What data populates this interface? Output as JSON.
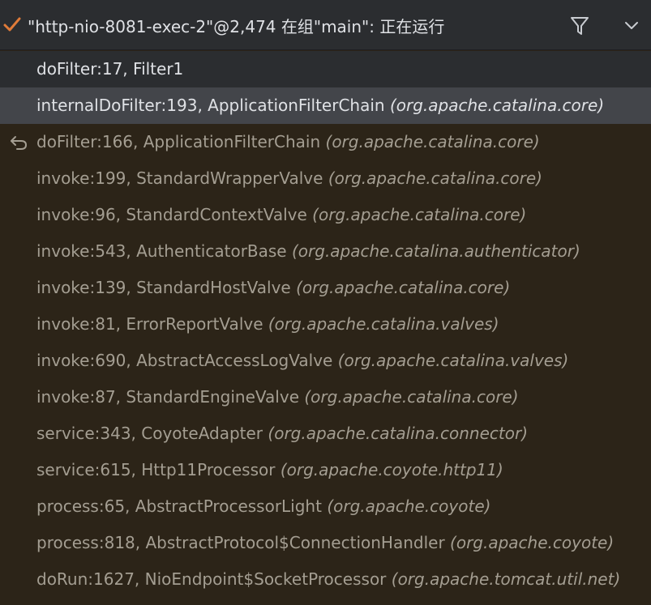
{
  "header": {
    "thread_title": "\"http-nio-8081-exec-2\"@2,474 在组\"main\": 正在运行",
    "status_icon": "check-icon",
    "status_color": "#e07b39",
    "filter_icon": "filter-icon",
    "expand_icon": "chevron-down-icon"
  },
  "frames": [
    {
      "method": "doFilter:17, Filter1",
      "package": "",
      "state": "own"
    },
    {
      "method": "internalDoFilter:193, ApplicationFilterChain",
      "package": "(org.apache.catalina.core)",
      "state": "selected"
    },
    {
      "method": "doFilter:166, ApplicationFilterChain",
      "package": "(org.apache.catalina.core)",
      "state": "library",
      "icon": "return-arrow-icon"
    },
    {
      "method": "invoke:199, StandardWrapperValve",
      "package": "(org.apache.catalina.core)",
      "state": "library"
    },
    {
      "method": "invoke:96, StandardContextValve",
      "package": "(org.apache.catalina.core)",
      "state": "library"
    },
    {
      "method": "invoke:543, AuthenticatorBase",
      "package": "(org.apache.catalina.authenticator)",
      "state": "library"
    },
    {
      "method": "invoke:139, StandardHostValve",
      "package": "(org.apache.catalina.core)",
      "state": "library"
    },
    {
      "method": "invoke:81, ErrorReportValve",
      "package": "(org.apache.catalina.valves)",
      "state": "library"
    },
    {
      "method": "invoke:690, AbstractAccessLogValve",
      "package": "(org.apache.catalina.valves)",
      "state": "library"
    },
    {
      "method": "invoke:87, StandardEngineValve",
      "package": "(org.apache.catalina.core)",
      "state": "library"
    },
    {
      "method": "service:343, CoyoteAdapter",
      "package": "(org.apache.catalina.connector)",
      "state": "library"
    },
    {
      "method": "service:615, Http11Processor",
      "package": "(org.apache.coyote.http11)",
      "state": "library"
    },
    {
      "method": "process:65, AbstractProcessorLight",
      "package": "(org.apache.coyote)",
      "state": "library"
    },
    {
      "method": "process:818, AbstractProtocol$ConnectionHandler",
      "package": "(org.apache.coyote)",
      "state": "library"
    },
    {
      "method": "doRun:1627, NioEndpoint$SocketProcessor",
      "package": "(org.apache.tomcat.util.net)",
      "state": "library"
    }
  ]
}
